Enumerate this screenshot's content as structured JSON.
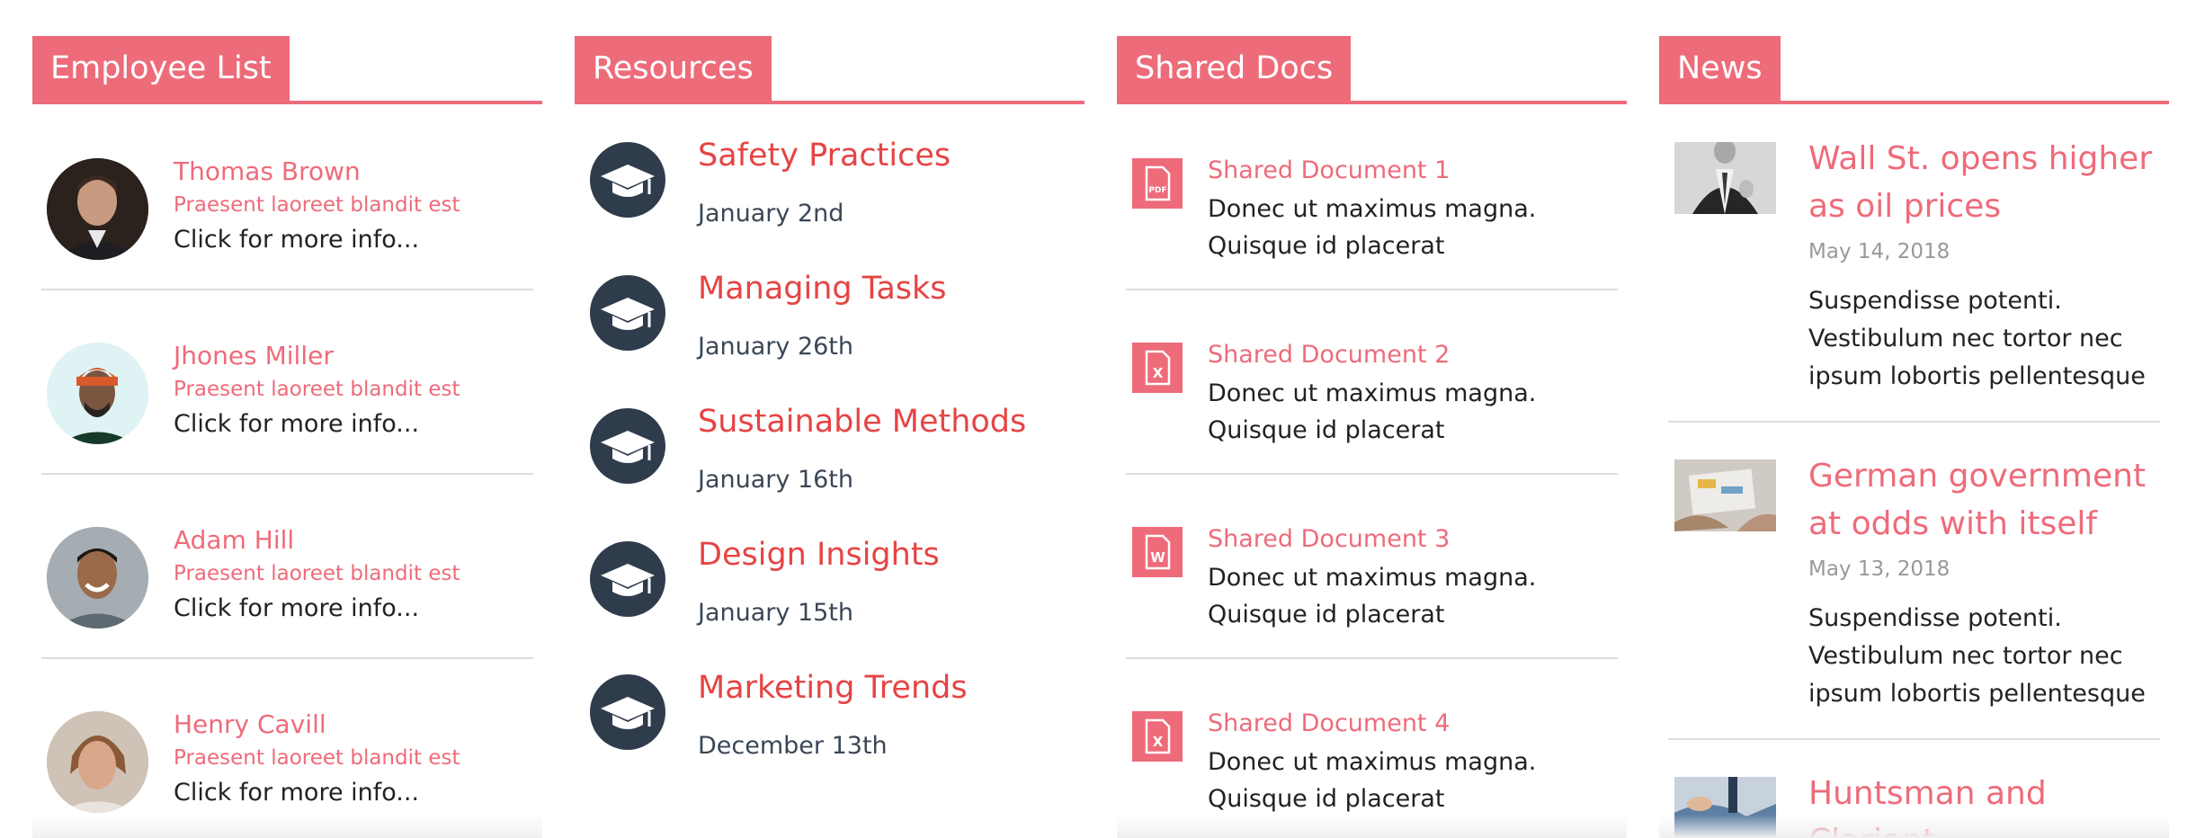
{
  "employee_list": {
    "title": "Employee List",
    "employees": [
      {
        "name": "Thomas Brown",
        "subtitle": "Praesent laoreet blandit est",
        "more": "Click for more info..."
      },
      {
        "name": "Jhones Miller",
        "subtitle": "Praesent laoreet blandit est",
        "more": "Click for more info..."
      },
      {
        "name": "Adam Hill",
        "subtitle": "Praesent laoreet blandit est",
        "more": "Click for more info..."
      },
      {
        "name": "Henry Cavill",
        "subtitle": "Praesent laoreet blandit est",
        "more": "Click for more info..."
      }
    ]
  },
  "resources": {
    "title": "Resources",
    "items": [
      {
        "title": "Safety Practices",
        "date": "January 2nd",
        "icon": "graduation-cap-icon"
      },
      {
        "title": "Managing Tasks",
        "date": "January 26th",
        "icon": "graduation-cap-icon"
      },
      {
        "title": "Sustainable Methods",
        "date": "January 16th",
        "icon": "graduation-cap-icon"
      },
      {
        "title": "Design Insights",
        "date": "January 15th",
        "icon": "graduation-cap-icon"
      },
      {
        "title": "Marketing Trends",
        "date": "December 13th",
        "icon": "graduation-cap-icon"
      }
    ]
  },
  "shared_docs": {
    "title": "Shared Docs",
    "docs": [
      {
        "title": "Shared Document 1",
        "description": "Donec ut maximus magna. Quisque id placerat",
        "icon": "pdf-file-icon",
        "icon_label": "PDF"
      },
      {
        "title": "Shared Document 2",
        "description": "Donec ut maximus magna. Quisque id placerat",
        "icon": "excel-file-icon",
        "icon_label": "X"
      },
      {
        "title": "Shared Document 3",
        "description": "Donec ut maximus magna. Quisque id placerat",
        "icon": "word-file-icon",
        "icon_label": "W"
      },
      {
        "title": "Shared Document 4",
        "description": "Donec ut maximus magna. Quisque id placerat",
        "icon": "excel-file-icon",
        "icon_label": "X"
      }
    ]
  },
  "news": {
    "title": "News",
    "articles": [
      {
        "title": "Wall St. opens higher as oil prices",
        "date": "May 14, 2018",
        "body": "Suspendisse potenti. Vestibulum nec tortor nec ipsum lobortis pellentesque"
      },
      {
        "title": "German government at odds with itself",
        "date": "May 13, 2018",
        "body": "Suspendisse potenti. Vestibulum nec tortor nec ipsum lobortis pellentesque"
      },
      {
        "title": "Huntsman and Clariant",
        "date": "",
        "body": ""
      }
    ]
  },
  "colors": {
    "accent": "#ee6b7a",
    "resource_title": "#e64444",
    "icon_dark": "#2f3c4c",
    "divider": "#dddddd"
  }
}
